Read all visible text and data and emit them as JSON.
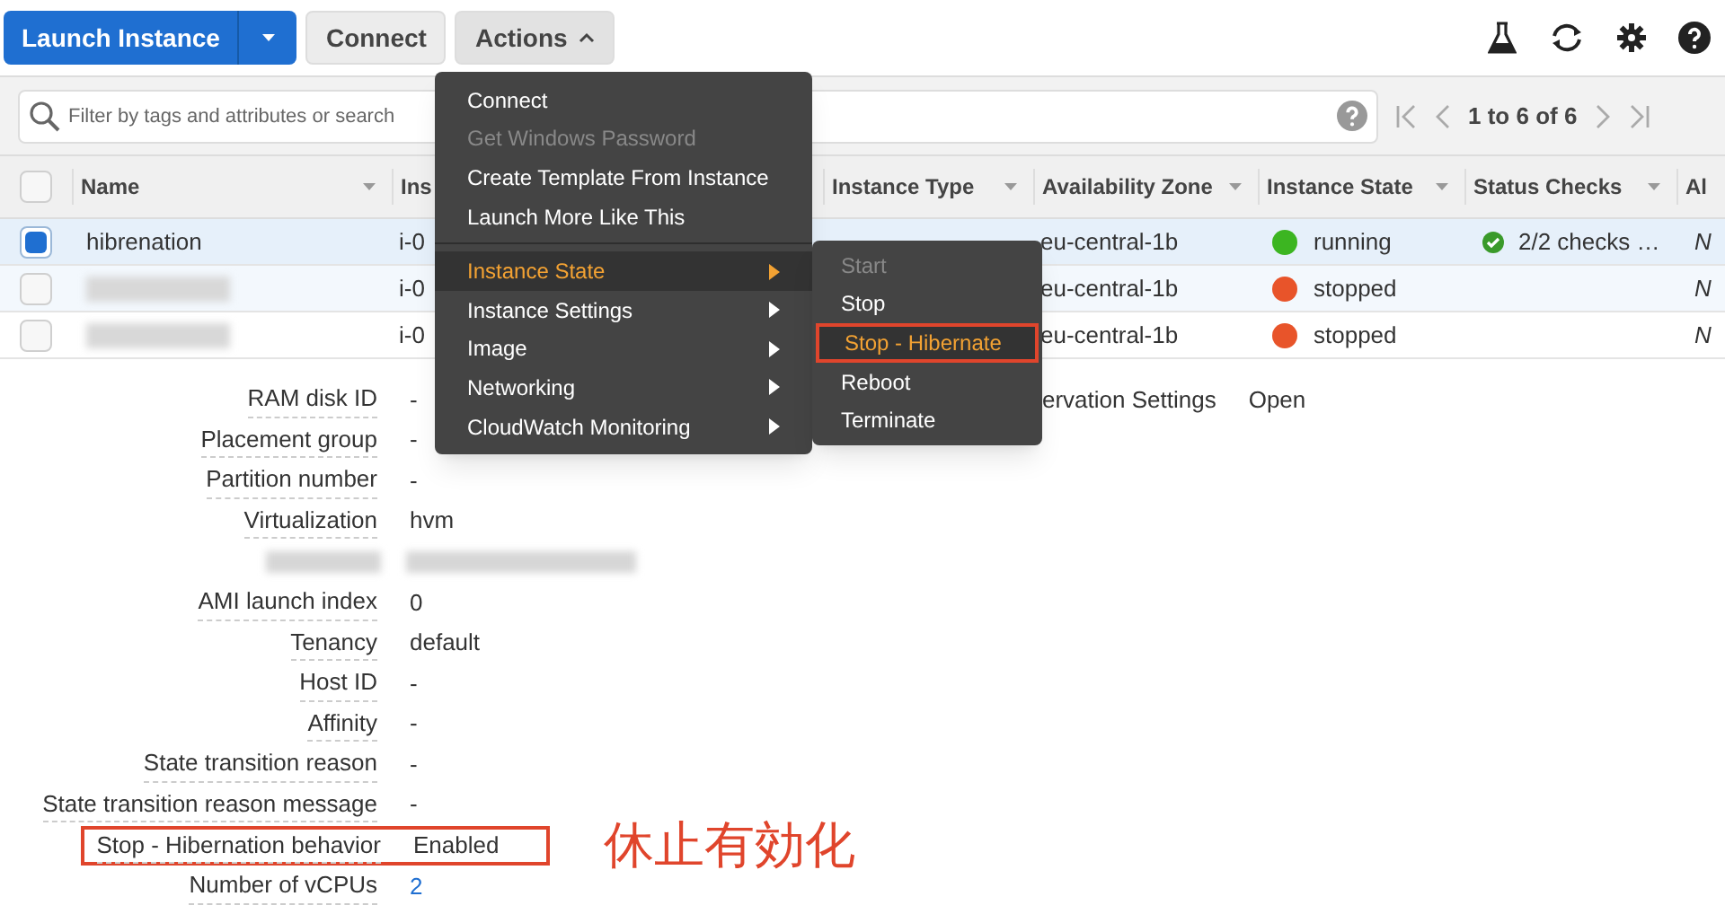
{
  "toolbar": {
    "launch_button": "Launch Instance",
    "connect_button": "Connect",
    "actions_button": "Actions",
    "actions_expanded": true
  },
  "filter": {
    "placeholder": "Filter by tags and attributes or search"
  },
  "pagination": {
    "range": "1 to 6 of 6"
  },
  "table": {
    "all_selected": false,
    "columns": [
      {
        "label": "Name",
        "sortable": true
      },
      {
        "label": "Ins",
        "sortable": false
      },
      {
        "label": "Instance Type",
        "sortable": true
      },
      {
        "label": "Availability Zone",
        "sortable": true
      },
      {
        "label": "Instance State",
        "sortable": true
      },
      {
        "label": "Status Checks",
        "sortable": true
      },
      {
        "label": "Al",
        "sortable": false
      }
    ],
    "rows": [
      {
        "selected": true,
        "name": "hibrenation",
        "name_blurred": false,
        "instance_id": "i-0",
        "zone": "eu-central-1b",
        "state": "running",
        "color": "#3cb521",
        "status": "2/2 checks …",
        "column_7": "N"
      },
      {
        "selected": false,
        "name_blurred": true,
        "instance_id": "i-0",
        "zone": "eu-central-1b",
        "state": "stopped",
        "color": "#e8542a",
        "column_7": "N"
      },
      {
        "selected": false,
        "name_blurred": true,
        "instance_id": "i-0",
        "zone": "eu-central-1b",
        "state": "stopped",
        "color": "#e8542a",
        "column_7": "N"
      }
    ]
  },
  "details": [
    {
      "kind": "text",
      "label": "RAM disk ID",
      "value": "-"
    },
    {
      "kind": "text",
      "label": "Placement group",
      "value": "-"
    },
    {
      "kind": "text",
      "label": "Partition number",
      "value": "-"
    },
    {
      "kind": "text",
      "label": "Virtualization",
      "value": "hvm"
    },
    {
      "kind": "blurred"
    },
    {
      "kind": "text",
      "label": "AMI launch index",
      "value": "0"
    },
    {
      "kind": "text",
      "label": "Tenancy",
      "value": "default"
    },
    {
      "kind": "text",
      "label": "Host ID",
      "value": "-"
    },
    {
      "kind": "text",
      "label": "Affinity",
      "value": "-"
    },
    {
      "kind": "text",
      "label": "State transition reason",
      "value": "-"
    },
    {
      "kind": "text",
      "label": "State transition reason message",
      "value": "-"
    },
    {
      "kind": "text",
      "label": "Stop - Hibernation behavior",
      "value": "Enabled",
      "highlighted": true
    },
    {
      "kind": "link",
      "label": "Number of vCPUs",
      "value": "2"
    }
  ],
  "details_right": {
    "label": "ervation Settings",
    "value": "Open"
  },
  "annotation": "休止有効化",
  "actions_menu": [
    {
      "kind": "item",
      "label": "Connect",
      "disabled": false
    },
    {
      "kind": "item",
      "label": "Get Windows Password",
      "disabled": true
    },
    {
      "kind": "item",
      "label": "Create Template From Instance",
      "disabled": false
    },
    {
      "kind": "item",
      "label": "Launch More Like This",
      "disabled": false
    },
    {
      "kind": "divider"
    },
    {
      "kind": "submenu",
      "label": "Instance State",
      "selected": true
    },
    {
      "kind": "submenu",
      "label": "Instance Settings",
      "selected": false
    },
    {
      "kind": "submenu",
      "label": "Image",
      "selected": false
    },
    {
      "kind": "submenu",
      "label": "Networking",
      "selected": false
    },
    {
      "kind": "submenu",
      "label": "CloudWatch Monitoring",
      "selected": false
    }
  ],
  "instance_state_menu": [
    {
      "label": "Start",
      "disabled": true,
      "selected": false
    },
    {
      "label": "Stop",
      "disabled": false,
      "selected": false
    },
    {
      "label": "Stop - Hibernate",
      "disabled": false,
      "selected": true
    },
    {
      "label": "Reboot",
      "disabled": false,
      "selected": false
    },
    {
      "label": "Terminate",
      "disabled": false,
      "selected": false
    }
  ]
}
